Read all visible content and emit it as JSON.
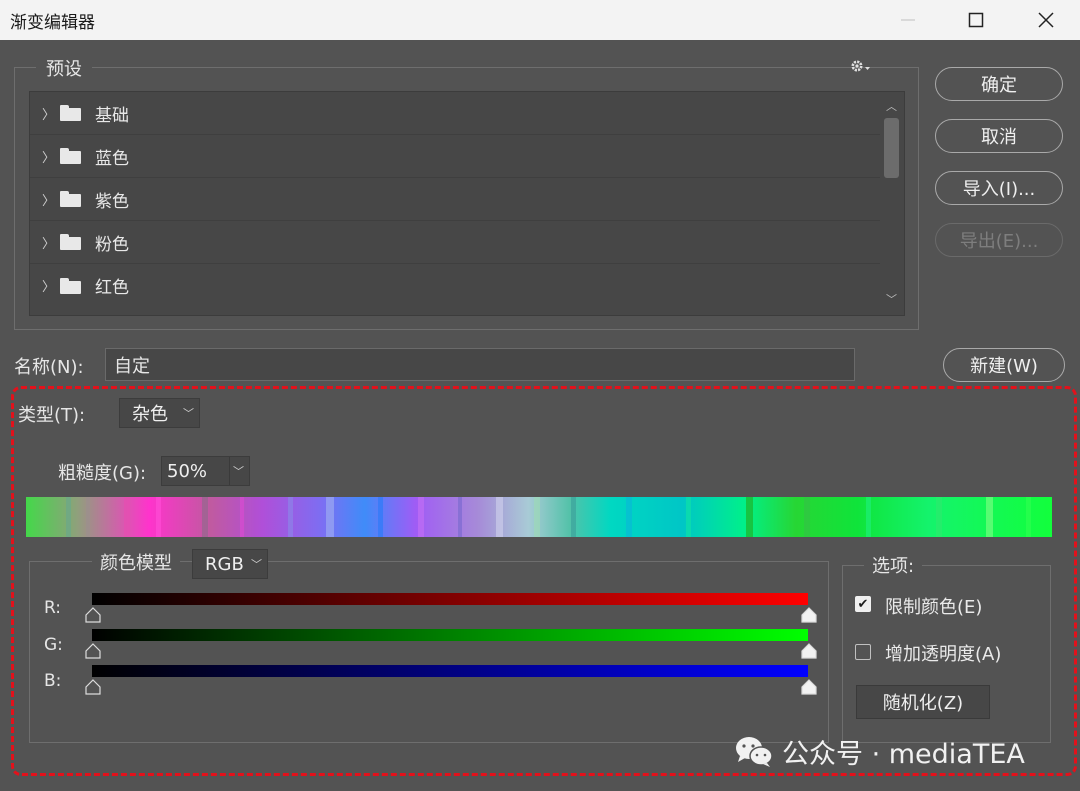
{
  "window": {
    "title": "渐变编辑器",
    "controls": [
      "minimize-icon",
      "maximize-icon",
      "close-icon"
    ]
  },
  "presets": {
    "label": "预设",
    "menu_icon": "gear-icon",
    "items": [
      {
        "label": "基础",
        "icon": "folder-icon"
      },
      {
        "label": "蓝色",
        "icon": "folder-icon"
      },
      {
        "label": "紫色",
        "icon": "folder-icon"
      },
      {
        "label": "粉色",
        "icon": "folder-icon"
      },
      {
        "label": "红色",
        "icon": "folder-icon"
      }
    ]
  },
  "buttons": {
    "ok": "确定",
    "cancel": "取消",
    "import": "导入(I)...",
    "export": "导出(E)...",
    "new": "新建(W)"
  },
  "name": {
    "label": "名称(N):",
    "value": "自定"
  },
  "type": {
    "label": "类型(T):",
    "value": "杂色"
  },
  "roughness": {
    "label": "粗糙度(G):",
    "value": "50%"
  },
  "color_model": {
    "label": "颜色模型",
    "value": "RGB",
    "channels": [
      {
        "label": "R:",
        "color": "#ff0000"
      },
      {
        "label": "G:",
        "color": "#00ff00"
      },
      {
        "label": "B:",
        "color": "#0000ff"
      }
    ]
  },
  "options": {
    "label": "选项:",
    "restrict_colors": {
      "label": "限制颜色(E)",
      "checked": true
    },
    "add_transparency": {
      "label": "增加透明度(A)",
      "checked": false
    },
    "randomize": "随机化(Z)"
  },
  "colors": {
    "highlight": "#e3111b",
    "dialog_bg": "#535353"
  },
  "watermark": "公众号 · mediaTEA"
}
